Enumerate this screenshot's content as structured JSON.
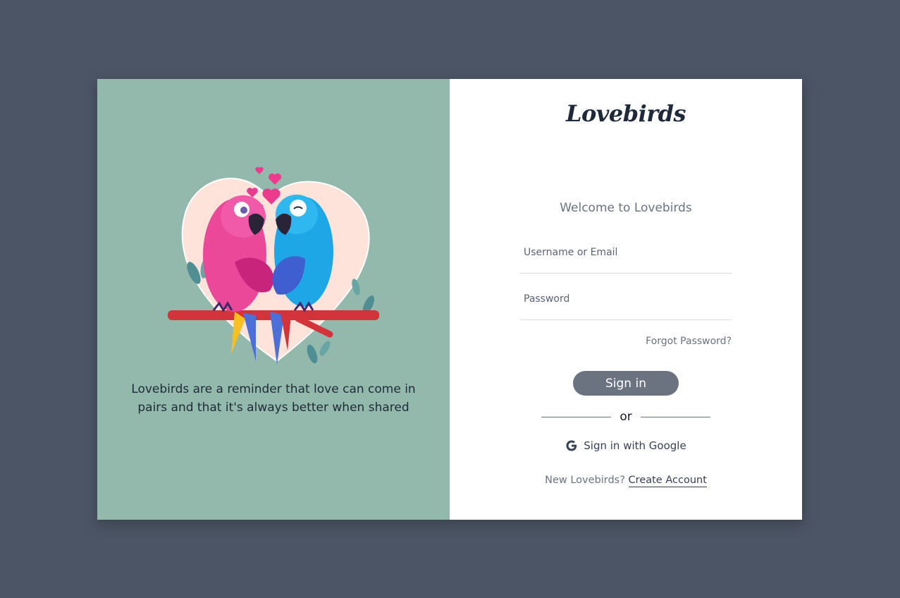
{
  "brand": "Lovebirds",
  "left_panel": {
    "tagline": "Lovebirds are a reminder that love can come in pairs and that it's always better when shared",
    "illustration": "two-parrots-on-branch-illustration"
  },
  "form": {
    "welcome": "Welcome to Lovebirds",
    "username_placeholder": "Username or Email",
    "username_value": "",
    "password_placeholder": "Password",
    "password_value": "",
    "forgot_label": "Forgot Password?",
    "signin_label": "Sign in",
    "or_label": "or",
    "google_label": "Sign in with Google",
    "google_icon": "google-g-icon",
    "new_prompt": "New Lovebirds?",
    "create_label": "Create Account"
  },
  "colors": {
    "page_bg": "#4c5565",
    "left_bg": "#93b9ac",
    "button_bg": "#6b7280",
    "heart_bg": "#fde3da",
    "pink_bird": "#ec4899",
    "blue_bird": "#1ea7e6",
    "branch": "#d3343c"
  }
}
